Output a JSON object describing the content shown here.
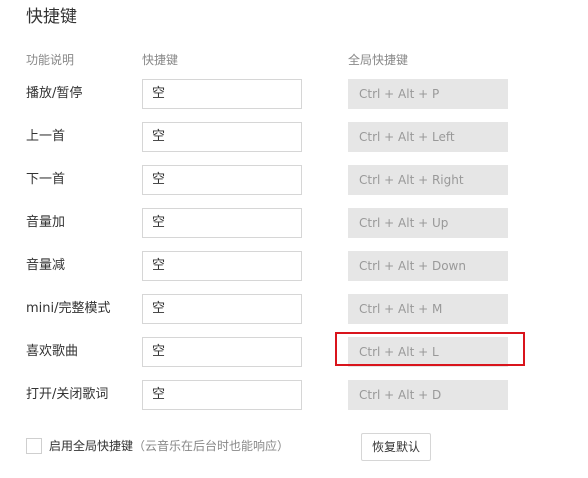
{
  "title": "快捷键",
  "headers": {
    "function": "功能说明",
    "shortcut": "快捷键",
    "global": "全局快捷键"
  },
  "rows": [
    {
      "label": "播放/暂停",
      "shortcut": "空",
      "global": "Ctrl + Alt + P"
    },
    {
      "label": "上一首",
      "shortcut": "空",
      "global": "Ctrl + Alt + Left"
    },
    {
      "label": "下一首",
      "shortcut": "空",
      "global": "Ctrl + Alt + Right"
    },
    {
      "label": "音量加",
      "shortcut": "空",
      "global": "Ctrl + Alt + Up"
    },
    {
      "label": "音量减",
      "shortcut": "空",
      "global": "Ctrl + Alt + Down"
    },
    {
      "label": "mini/完整模式",
      "shortcut": "空",
      "global": "Ctrl + Alt + M"
    },
    {
      "label": "喜欢歌曲",
      "shortcut": "空",
      "global": "Ctrl + Alt + L"
    },
    {
      "label": "打开/关闭歌词",
      "shortcut": "空",
      "global": "Ctrl + Alt + D"
    }
  ],
  "footer": {
    "checkbox_label": "启用全局快捷键",
    "checkbox_hint": "（云音乐在后台时也能响应）",
    "checkbox_checked": false,
    "restore_button": "恢复默认"
  },
  "highlight": {
    "row_index": 6,
    "color": "#d9141c"
  }
}
